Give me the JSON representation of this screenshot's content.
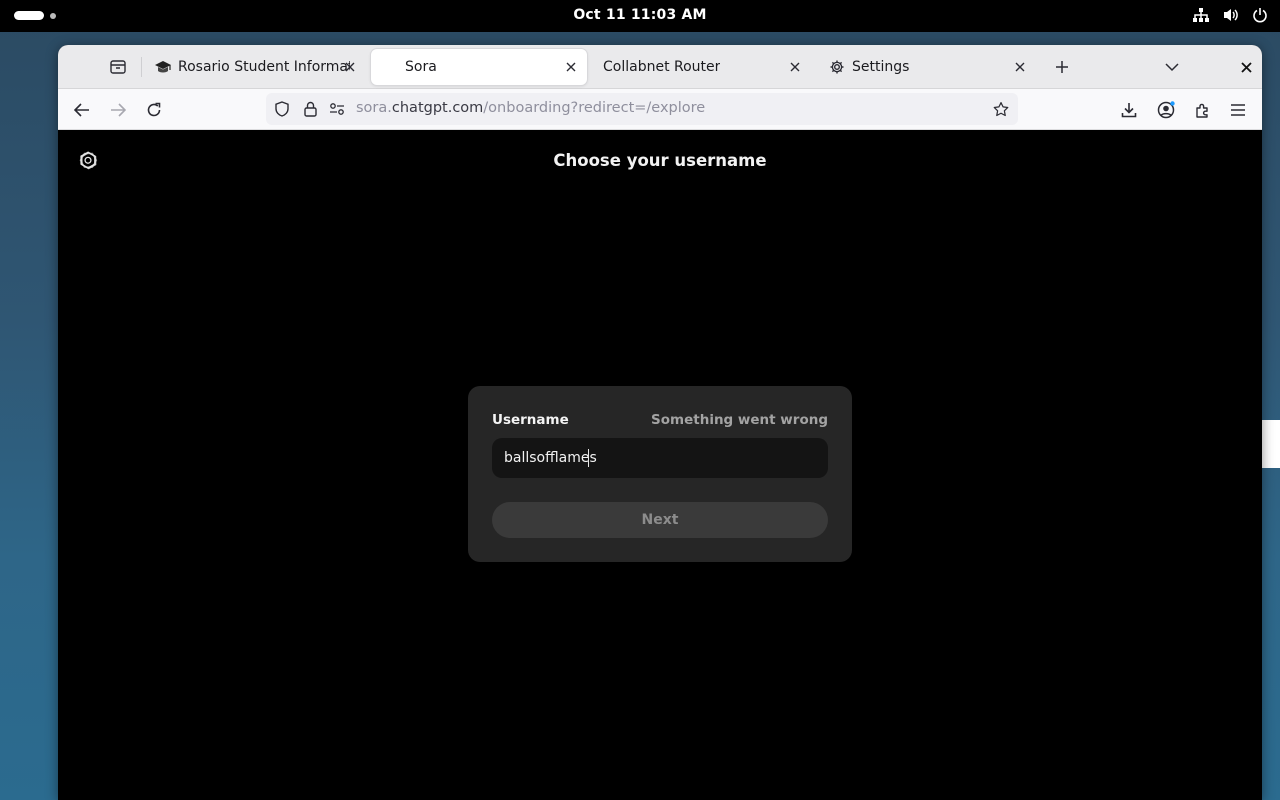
{
  "system": {
    "clock": "Oct 11  11:03 AM",
    "tray_icons": [
      "network-icon",
      "volume-icon",
      "power-icon"
    ]
  },
  "browser": {
    "tabs": [
      {
        "title": "Rosario Student Informati",
        "icon": "graduation-cap-icon",
        "active": false
      },
      {
        "title": "Sora",
        "icon": "blank-favicon",
        "active": true
      },
      {
        "title": "Collabnet Router",
        "icon": "none",
        "active": false
      },
      {
        "title": "Settings",
        "icon": "gear-icon",
        "active": false
      }
    ],
    "url": {
      "prefix": "sora.",
      "host": "chatgpt.com",
      "path": "/onboarding?redirect=/explore"
    }
  },
  "page": {
    "title": "Choose your username",
    "form": {
      "label": "Username",
      "error": "Something went wrong",
      "value": "ballsofflames",
      "next_label": "Next"
    }
  },
  "colors": {
    "page_bg": "#000000",
    "card_bg": "#262626",
    "input_bg": "#141414",
    "button_bg": "#3a3a3a",
    "error_text": "#a3a3a3"
  }
}
